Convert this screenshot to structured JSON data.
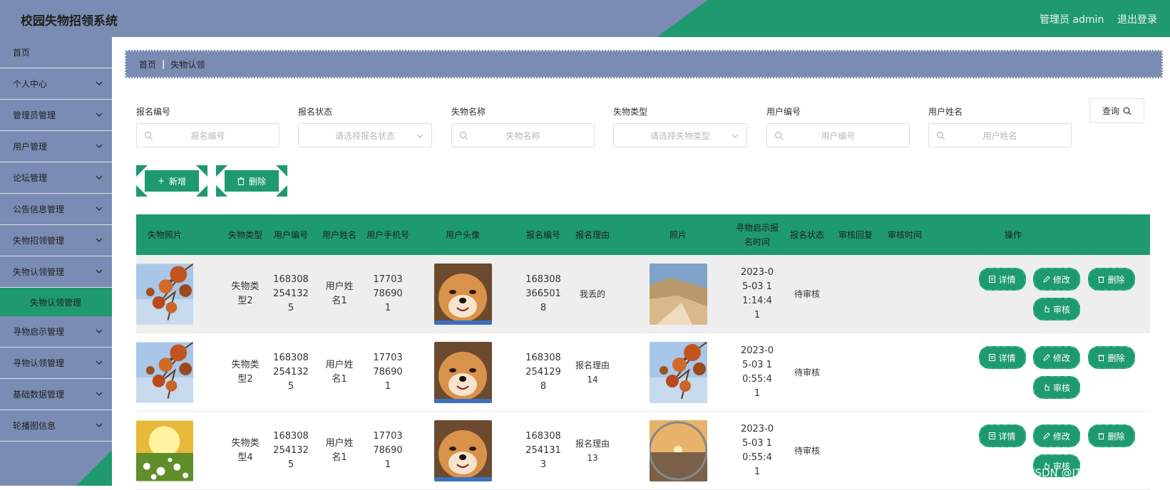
{
  "header": {
    "title": "校园失物招领系统",
    "user": "管理员 admin",
    "logout": "退出登录"
  },
  "sidebar": {
    "items": [
      {
        "label": "首页",
        "chevron": false
      },
      {
        "label": "个人中心",
        "chevron": true
      },
      {
        "label": "管理员管理",
        "chevron": true
      },
      {
        "label": "用户管理",
        "chevron": true
      },
      {
        "label": "论坛管理",
        "chevron": true
      },
      {
        "label": "公告信息管理",
        "chevron": true
      },
      {
        "label": "失物招领管理",
        "chevron": true
      },
      {
        "label": "失物认领管理",
        "chevron": true
      }
    ],
    "active_sub": "失物认领管理",
    "items_after": [
      {
        "label": "寻物启示管理",
        "chevron": true
      },
      {
        "label": "寻物认领管理",
        "chevron": true
      },
      {
        "label": "基础数据管理",
        "chevron": true
      },
      {
        "label": "轮播图信息",
        "chevron": true
      }
    ]
  },
  "breadcrumb": {
    "home": "首页",
    "current": "失物认领"
  },
  "filters": [
    {
      "label": "报名编号",
      "placeholder": "报名编号",
      "type": "text"
    },
    {
      "label": "报名状态",
      "placeholder": "请选择报名状态",
      "type": "select"
    },
    {
      "label": "失物名称",
      "placeholder": "失物名称",
      "type": "text"
    },
    {
      "label": "失物类型",
      "placeholder": "请选择失物类型",
      "type": "select"
    },
    {
      "label": "用户编号",
      "placeholder": "用户编号",
      "type": "text"
    },
    {
      "label": "用户姓名",
      "placeholder": "用户姓名",
      "type": "text"
    }
  ],
  "query_label": "查询",
  "actions": {
    "add": "新增",
    "delete": "删除"
  },
  "table": {
    "headers": [
      "失物照片",
      "失物类型",
      "用户编号",
      "用户姓名",
      "用户手机号",
      "用户头像",
      "报名编号",
      "报名理由",
      "照片",
      "寻物启示报名时间",
      "报名状态",
      "审核回复",
      "审核时间",
      "操作"
    ],
    "rows": [
      {
        "type": "失物类型2",
        "user_no": "1683082541325",
        "user_name": "用户姓名1",
        "phone": "17703786901",
        "sign_no": "1683083665018",
        "reason": "我丢的",
        "photo": "valley",
        "lost_photo": "autumn",
        "time": "2023-05-03 11:14:41",
        "status": "待审核",
        "reply": "",
        "audit_time": ""
      },
      {
        "type": "失物类型2",
        "user_no": "1683082541325",
        "user_name": "用户姓名1",
        "phone": "17703786901",
        "sign_no": "1683082541298",
        "reason": "报名理由14",
        "photo": "autumn",
        "lost_photo": "autumn",
        "time": "2023-05-03 10:55:41",
        "status": "待审核",
        "reply": "",
        "audit_time": ""
      },
      {
        "type": "失物类型4",
        "user_no": "1683082541325",
        "user_name": "用户姓名1",
        "phone": "17703786901",
        "sign_no": "1683082541313",
        "reason": "报名理由13",
        "photo": "sunset",
        "lost_photo": "flowers",
        "time": "2023-05-03 10:55:41",
        "status": "待审核",
        "reply": "",
        "audit_time": ""
      }
    ],
    "ops": {
      "detail": "详情",
      "edit": "修改",
      "delete": "删除",
      "audit": "审核"
    }
  },
  "watermark": "CSDN @IT毕设梦工厂",
  "colors": {
    "primary_green": "#1e9a6e",
    "slate_blue": "#7a8cb3"
  }
}
